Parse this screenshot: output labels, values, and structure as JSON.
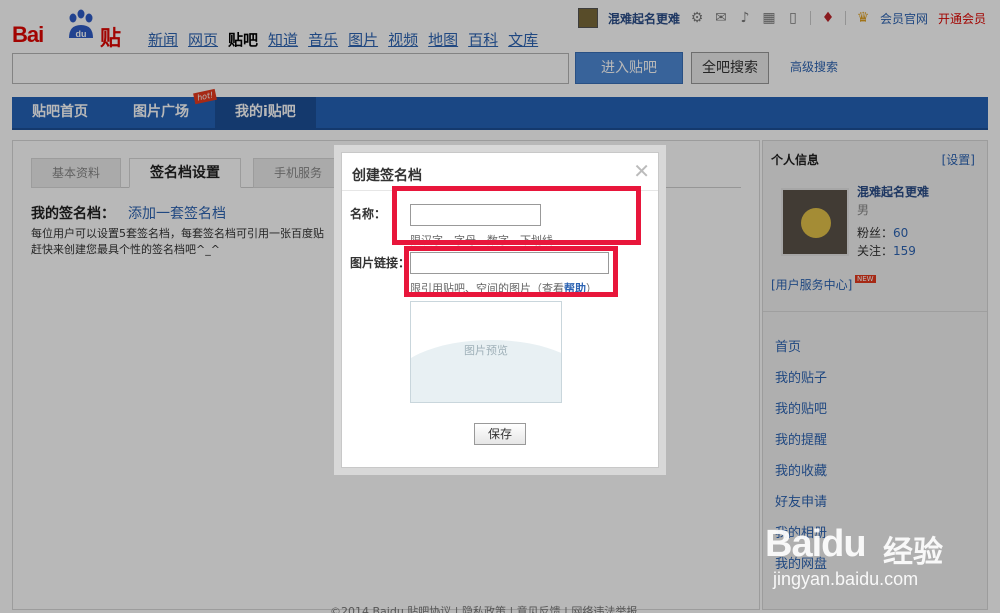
{
  "header": {
    "logo_text_bai": "Bai",
    "logo_text_du": "du",
    "logo_text_tieba": "贴吧",
    "nav": [
      "新闻",
      "网页",
      "贴吧",
      "知道",
      "音乐",
      "图片",
      "视频",
      "地图",
      "百科",
      "文库"
    ],
    "nav_current": "贴吧"
  },
  "topbar": {
    "username": "混难起名更难",
    "vip_label": "会员官网",
    "open_vip_label": "开通会员"
  },
  "search": {
    "enter_button": "进入贴吧",
    "all_search_button": "全吧搜索",
    "advanced_link": "高级搜索"
  },
  "mainnav": {
    "items": [
      "贴吧首页",
      "图片广场",
      "我的i贴吧"
    ],
    "hot_badge": "hot!"
  },
  "tabs": [
    "基本资料",
    "签名档设置",
    "手机服务"
  ],
  "signature": {
    "title": "我的签名档：",
    "add_link": "添加一套签名档",
    "desc_line1": "每位用户可以设置5套签名档，每套签名档可引用一张百度贴",
    "desc_line2": "赶快来创建您最具个性的签名档吧^_^"
  },
  "sidebar": {
    "heading": "个人信息",
    "settings_link": "[设置]",
    "username": "混难起名更难",
    "gender": "男",
    "fans_label": "粉丝：",
    "fans_value": "60",
    "follow_label": "关注：",
    "follow_value": "159",
    "service_center": "[用户服务中心]",
    "new_badge": "NEW",
    "menu": [
      "首页",
      "我的贴子",
      "我的贴吧",
      "我的提醒",
      "我的收藏",
      "好友申请",
      "我的相册",
      "我的网盘"
    ]
  },
  "modal": {
    "title": "创建签名档",
    "close_glyph": "✕",
    "name_label": "名称：",
    "name_value": "",
    "name_hint": "限汉字、字母、数字、下划线",
    "image_label": "图片链接：",
    "image_value": "",
    "image_hint_prefix": "限引用贴吧、空间的图片（查看",
    "image_hint_link": "帮助",
    "image_hint_suffix": "）",
    "preview_text": "图片预览",
    "save_button": "保存"
  },
  "footer": {
    "text": "©2014 Baidu 贴吧协议 | 隐私政策 | 意见反馈 | 网络违法举报"
  },
  "watermark": {
    "brand": "Baidu",
    "cn": "经验",
    "url": "jingyan.baidu.com"
  },
  "colors": {
    "brand_red": "#e10602",
    "nav_blue": "#2563b8",
    "link_blue": "#2d64b3",
    "annotation_red": "#e8163b"
  }
}
